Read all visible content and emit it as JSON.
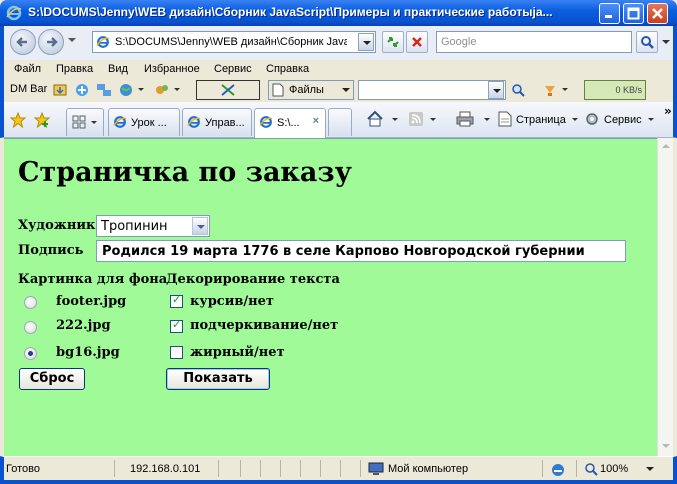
{
  "window": {
    "title": "S:\\DOCUMS\\Jenny\\WEB дизайн\\Сборник JavaScript\\Примеры и практические работыja..."
  },
  "address_bar": {
    "url": "S:\\DOCUMS\\Jenny\\WEB дизайн\\Сборник JavaScr",
    "search_placeholder": "Google"
  },
  "menu": {
    "items": [
      "Файл",
      "Правка",
      "Вид",
      "Избранное",
      "Сервис",
      "Справка"
    ]
  },
  "toolbar": {
    "dm_bar": "DM Bar",
    "files_label": "Файлы",
    "speed": "0 KB/s"
  },
  "tabs": {
    "items": [
      {
        "label": "Урок ..."
      },
      {
        "label": "Управ..."
      },
      {
        "label": "S:\\..."
      }
    ],
    "active_index": 2,
    "commands": {
      "page": "Страница",
      "service": "Сервис"
    }
  },
  "page": {
    "heading": "Страничка по заказу",
    "artist_label": "Художник",
    "artist_value": "Тропинин",
    "caption_label": "Подпись",
    "caption_value": "Родился 19  марта 1776 в селе Карпово Новгородской губернии",
    "bg_picture_label": "Картинка для фона",
    "text_decoration_label": "Декорирование текста",
    "backgrounds": [
      {
        "label": "footer.jpg",
        "selected": false
      },
      {
        "label": "222.jpg",
        "selected": false
      },
      {
        "label": "bg16.jpg",
        "selected": true
      }
    ],
    "decorations": [
      {
        "label": "курсив/нет",
        "checked": true
      },
      {
        "label": "подчеркивание/нет",
        "checked": true
      },
      {
        "label": "жирный/нет",
        "checked": false
      }
    ],
    "reset_button": "Сброс",
    "show_button": "Показать",
    "background_color": "#A0FA98"
  },
  "status": {
    "text": "Готово",
    "ip": "192.168.0.101",
    "zone": "Мой компьютер",
    "zoom": "100%"
  }
}
